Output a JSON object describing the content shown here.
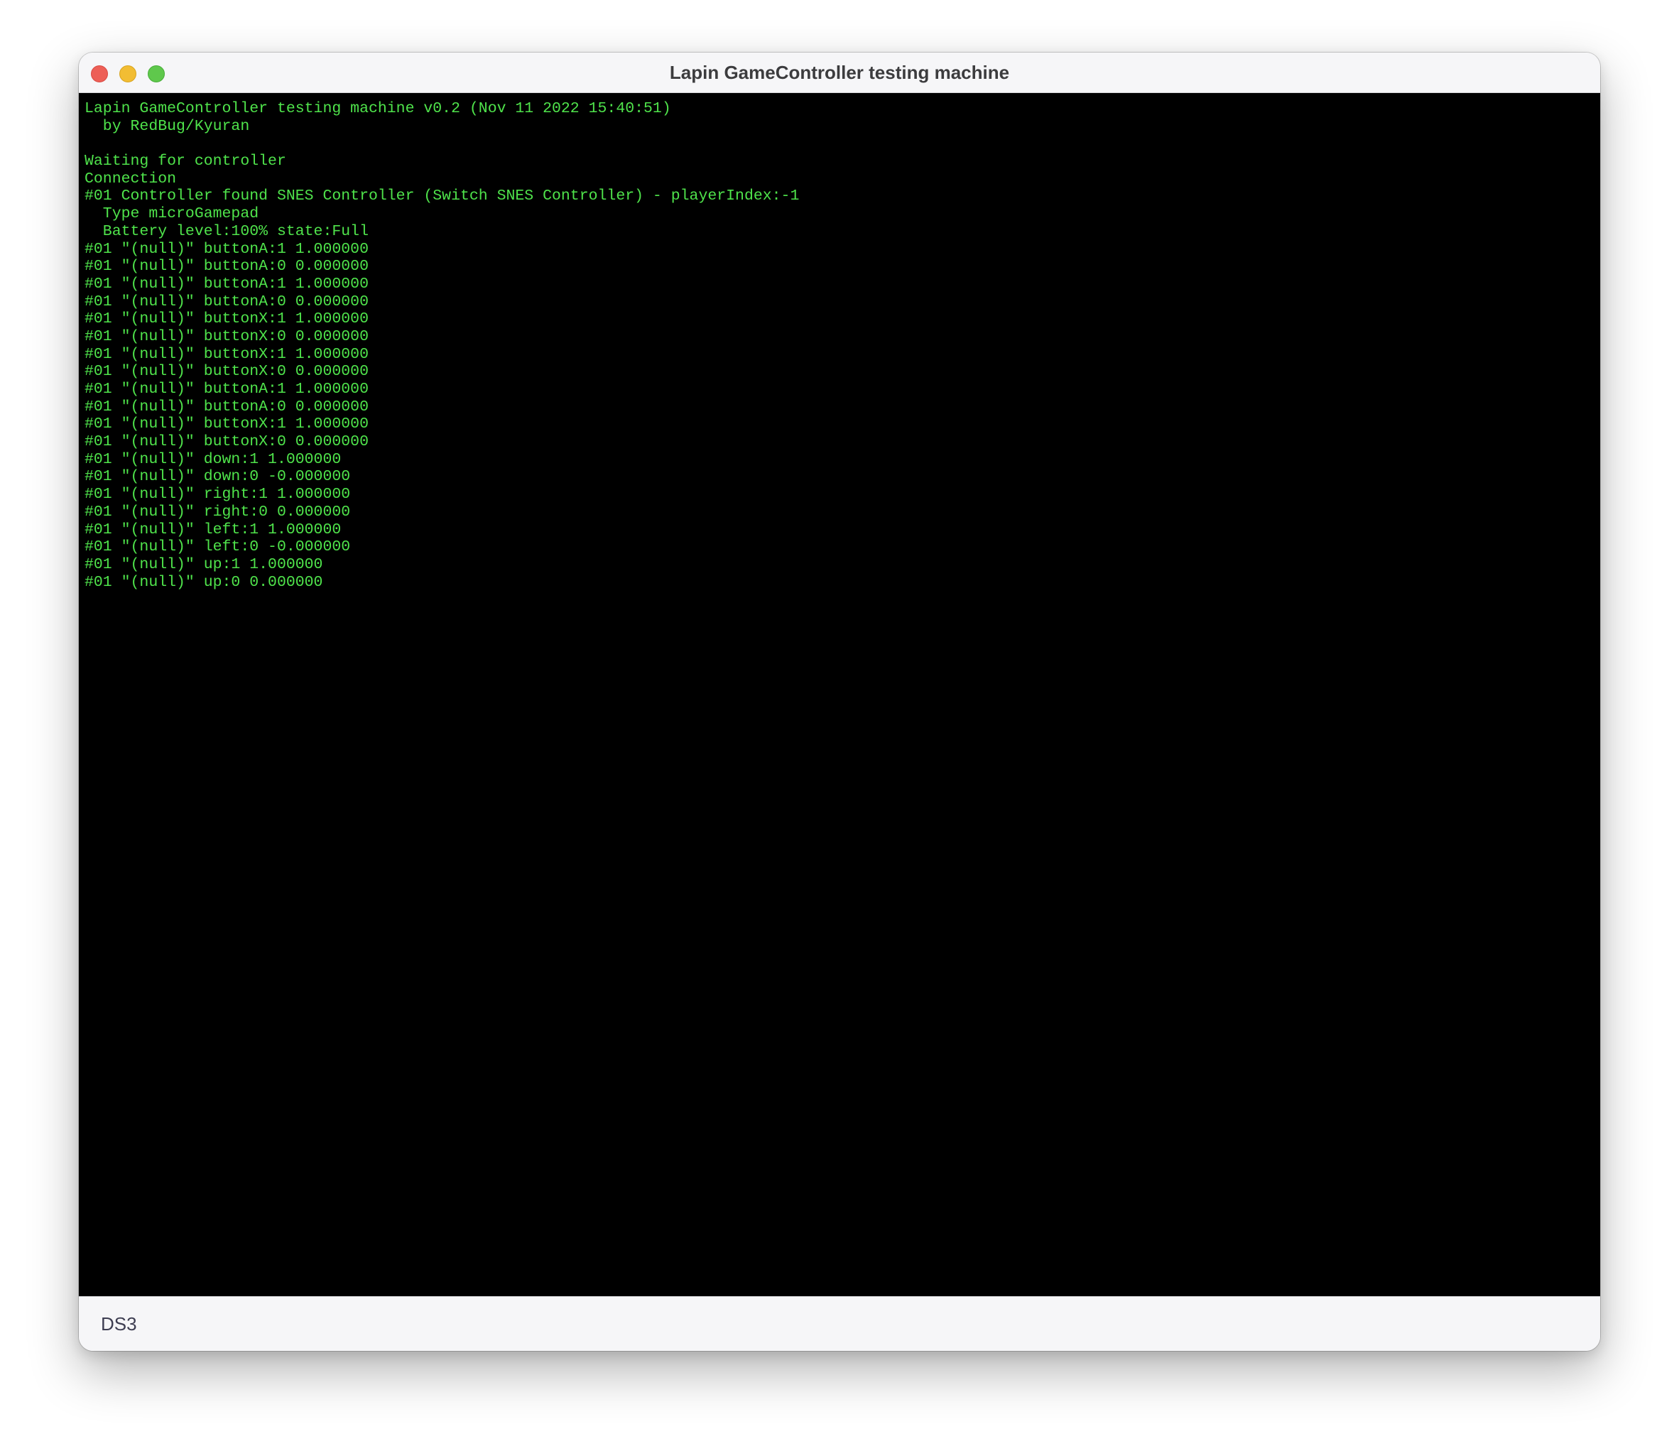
{
  "window": {
    "title": "Lapin GameController testing machine"
  },
  "console": {
    "text_color": "#4fe34b",
    "background_color": "#000000",
    "lines": [
      "Lapin GameController testing machine v0.2 (Nov 11 2022 15:40:51)",
      "  by RedBug/Kyuran",
      "",
      "Waiting for controller",
      "Connection",
      "#01 Controller found SNES Controller (Switch SNES Controller) - playerIndex:-1",
      "  Type microGamepad",
      "  Battery level:100% state:Full",
      "#01 \"(null)\" buttonA:1 1.000000",
      "#01 \"(null)\" buttonA:0 0.000000",
      "#01 \"(null)\" buttonA:1 1.000000",
      "#01 \"(null)\" buttonA:0 0.000000",
      "#01 \"(null)\" buttonX:1 1.000000",
      "#01 \"(null)\" buttonX:0 0.000000",
      "#01 \"(null)\" buttonX:1 1.000000",
      "#01 \"(null)\" buttonX:0 0.000000",
      "#01 \"(null)\" buttonA:1 1.000000",
      "#01 \"(null)\" buttonA:0 0.000000",
      "#01 \"(null)\" buttonX:1 1.000000",
      "#01 \"(null)\" buttonX:0 0.000000",
      "#01 \"(null)\" down:1 1.000000",
      "#01 \"(null)\" down:0 -0.000000",
      "#01 \"(null)\" right:1 1.000000",
      "#01 \"(null)\" right:0 0.000000",
      "#01 \"(null)\" left:1 1.000000",
      "#01 \"(null)\" left:0 -0.000000",
      "#01 \"(null)\" up:1 1.000000",
      "#01 \"(null)\" up:0 0.000000"
    ]
  },
  "statusbar": {
    "label": "DS3"
  }
}
